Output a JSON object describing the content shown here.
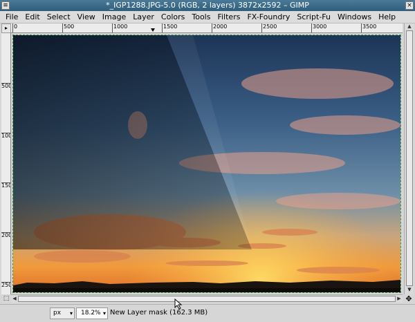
{
  "window": {
    "title": "*_IGP1288.JPG-5.0 (RGB, 2 layers) 3872x2592 – GIMP",
    "menu_glyph": "≡",
    "close_glyph": "×"
  },
  "menubar": {
    "items": [
      "File",
      "Edit",
      "Select",
      "View",
      "Image",
      "Layer",
      "Colors",
      "Tools",
      "Filters",
      "FX-Foundry",
      "Script-Fu",
      "Windows",
      "Help"
    ]
  },
  "rulers": {
    "horizontal": [
      "0",
      "500",
      "1000",
      "1500",
      "2000",
      "2500",
      "3000",
      "3500"
    ],
    "vertical": [
      "500",
      "1000",
      "1500",
      "2000",
      "2500"
    ]
  },
  "corner_glyph": "▸",
  "quickmask_glyph": "⬚",
  "navigate_glyph": "✥",
  "scroll_up_glyph": "▲",
  "scroll_down_glyph": "▼",
  "scroll_left_glyph": "◀",
  "scroll_right_glyph": "▶",
  "statusbar": {
    "unit": "px",
    "zoom": "18.2%",
    "message": "New Layer mask (162.3 MB)",
    "dropdown_glyph": "▾"
  }
}
